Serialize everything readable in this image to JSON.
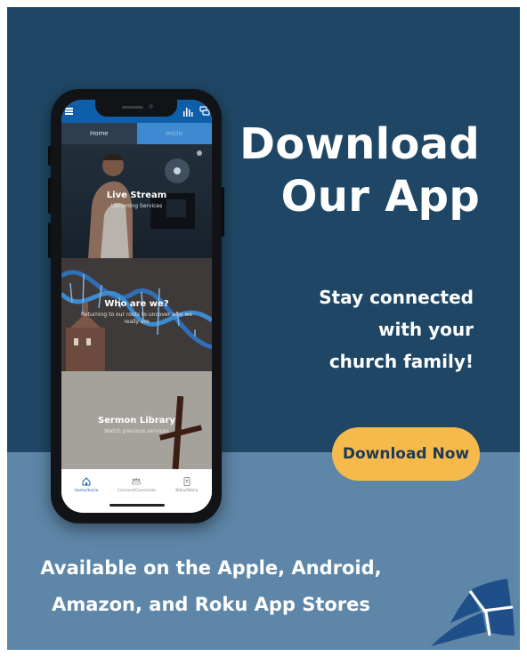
{
  "headline": {
    "line1": "Download",
    "line2": "Our App"
  },
  "subheadline": {
    "line1": "Stay connected",
    "line2": "with your",
    "line3": "church family!"
  },
  "cta": {
    "label": "Download Now"
  },
  "availability": {
    "line1": "Available on the Apple, Android,",
    "line2": "Amazon, and Roku App Stores"
  },
  "phone": {
    "tabs": [
      {
        "label": "Home"
      },
      {
        "label": "Inicio"
      }
    ],
    "cards": [
      {
        "title": "Live Stream",
        "subtitle": "Upcoming Services"
      },
      {
        "title": "Who are we?",
        "subtitle": "Returning to our roots to uncover who we really are"
      },
      {
        "title": "Sermon Library",
        "subtitle": "Watch previous services"
      }
    ],
    "bottom_nav": [
      {
        "label": "Home/Inicio",
        "icon": "home-icon"
      },
      {
        "label": "Connect/Conectate",
        "icon": "people-icon"
      },
      {
        "label": "Bible/Biblia",
        "icon": "bible-icon"
      }
    ]
  },
  "colors": {
    "top_panel": "#1f4765",
    "bottom_panel": "#5e86a8",
    "cta_fill": "#f6ba4c",
    "cta_text": "#1f3a55",
    "app_bar": "#0f5ea9"
  }
}
